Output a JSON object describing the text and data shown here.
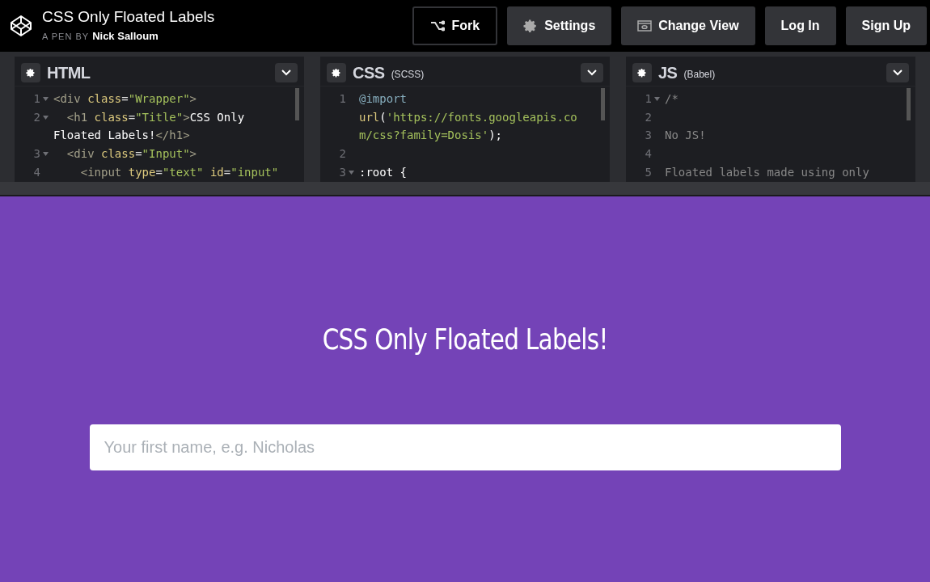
{
  "header": {
    "title": "CSS Only Floated Labels",
    "byline": "A PEN BY",
    "author": "Nick Salloum"
  },
  "buttons": [
    {
      "label": "Fork",
      "kind": "fork"
    },
    {
      "label": "Settings",
      "kind": "settings"
    },
    {
      "label": "Change View",
      "kind": "view"
    },
    {
      "label": "Log In",
      "kind": "plain"
    },
    {
      "label": "Sign Up",
      "kind": "plain"
    }
  ],
  "editors": [
    {
      "title": "HTML",
      "lines": [
        {
          "number": "1",
          "fold": true,
          "tokens": [
            {
              "text": "<div",
              "kind": "tag"
            },
            {
              "text": " class",
              "kind": "attr"
            },
            {
              "text": "=",
              "kind": "punct"
            },
            {
              "text": "\"Wrapper\"",
              "kind": "string"
            },
            {
              "text": ">",
              "kind": "tag"
            }
          ]
        },
        {
          "number": "2",
          "fold": true,
          "tokens": [
            {
              "text": "  <h1",
              "kind": "tag"
            },
            {
              "text": " class",
              "kind": "attr"
            },
            {
              "text": "=",
              "kind": "punct"
            },
            {
              "text": "\"Title\"",
              "kind": "string"
            },
            {
              "text": ">",
              "kind": "tag"
            },
            {
              "text": "CSS Only",
              "kind": "text"
            }
          ]
        },
        {
          "fold": false,
          "tokens": [
            {
              "text": "Floated Labels!",
              "kind": "text"
            },
            {
              "text": "</h1>",
              "kind": "tag"
            }
          ]
        },
        {
          "number": "3",
          "fold": true,
          "tokens": [
            {
              "text": "  <div",
              "kind": "tag"
            },
            {
              "text": " class",
              "kind": "attr"
            },
            {
              "text": "=",
              "kind": "punct"
            },
            {
              "text": "\"Input\"",
              "kind": "string"
            },
            {
              "text": ">",
              "kind": "tag"
            }
          ]
        },
        {
          "number": "4",
          "fold": false,
          "tokens": [
            {
              "text": "    <input",
              "kind": "tag"
            },
            {
              "text": " type",
              "kind": "attr"
            },
            {
              "text": "=",
              "kind": "punct"
            },
            {
              "text": "\"text\"",
              "kind": "string"
            },
            {
              "text": " id",
              "kind": "attr"
            },
            {
              "text": "=",
              "kind": "punct"
            },
            {
              "text": "\"input\"",
              "kind": "string"
            }
          ]
        }
      ]
    },
    {
      "title": "CSS",
      "subtitle": "(SCSS)",
      "lines": [
        {
          "number": "1",
          "fold": false,
          "tokens": [
            {
              "text": "@import",
              "kind": "atrule"
            }
          ]
        },
        {
          "fold": false,
          "tokens": [
            {
              "text": "url",
              "kind": "attr"
            },
            {
              "text": "(",
              "kind": "text"
            },
            {
              "text": "'https://fonts.googleapis.co",
              "kind": "string"
            }
          ]
        },
        {
          "fold": false,
          "tokens": [
            {
              "text": "m/css?family=Dosis'",
              "kind": "string"
            },
            {
              "text": ");",
              "kind": "text"
            }
          ]
        },
        {
          "number": "2",
          "fold": false
        },
        {
          "number": "3",
          "fold": true,
          "tokens": [
            {
              "text": ":root {",
              "kind": "text"
            }
          ]
        }
      ]
    },
    {
      "title": "JS",
      "subtitle": "(Babel)",
      "lines": [
        {
          "number": "1",
          "fold": true,
          "tokens": [
            {
              "text": "/*",
              "kind": "comment"
            }
          ]
        },
        {
          "number": "2",
          "fold": false
        },
        {
          "number": "3",
          "fold": false,
          "tokens": [
            {
              "text": "No JS!",
              "kind": "comment"
            }
          ]
        },
        {
          "number": "4",
          "fold": false
        },
        {
          "number": "5",
          "fold": false,
          "tokens": [
            {
              "text": "Floated labels made using only",
              "kind": "comment"
            }
          ]
        }
      ]
    }
  ],
  "preview": {
    "heading": "CSS Only Floated Labels!",
    "input": {
      "placeholder": "Your first name, e.g. Nicholas"
    }
  }
}
